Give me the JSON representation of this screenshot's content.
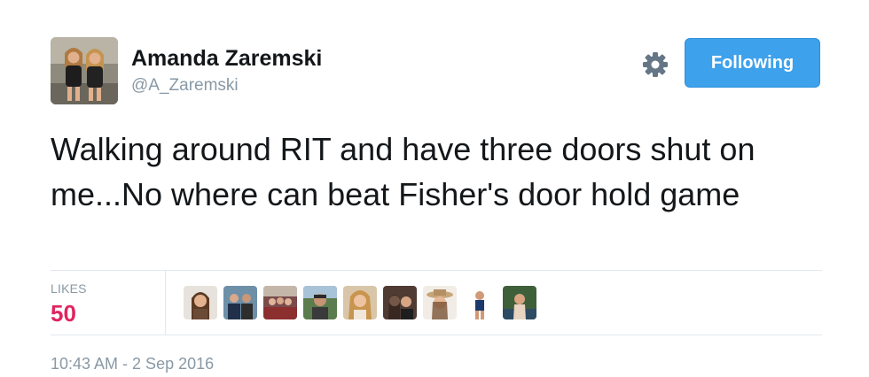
{
  "user": {
    "display_name": "Amanda Zaremski",
    "screen_name": "@A_Zaremski"
  },
  "actions": {
    "settings_icon": "gear-icon",
    "follow_label": "Following"
  },
  "tweet": {
    "text": "Walking around RIT and have three doors shut on me...No where can beat Fisher's door hold game"
  },
  "stats": {
    "likes_label": "LIKES",
    "likes_count": "50",
    "liker_avatar_count_shown": 9
  },
  "meta": {
    "timestamp": "10:43 AM - 2 Sep 2016"
  },
  "colors": {
    "accent": "#3ea1ec",
    "likes": "#e0245e",
    "muted": "#8899a6",
    "text": "#14171a",
    "divider": "#e1e8ed"
  }
}
